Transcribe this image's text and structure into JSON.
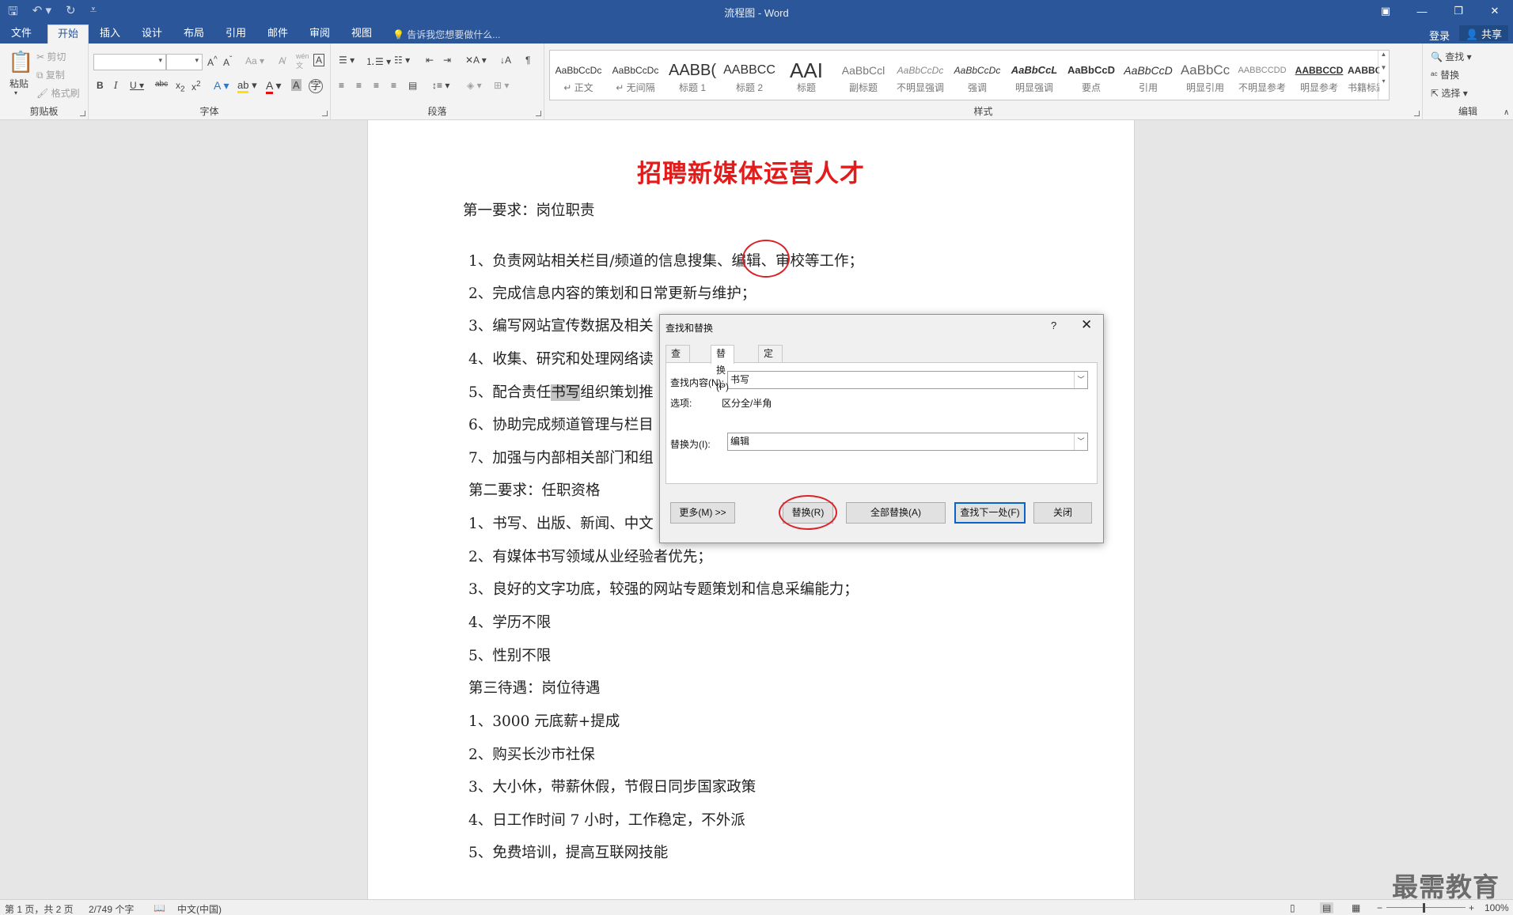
{
  "window": {
    "title": "流程图 - Word",
    "qat": [
      "save-icon",
      "undo-icon",
      "redo-icon",
      "customize-icon"
    ]
  },
  "tabs": [
    {
      "label": "文件"
    },
    {
      "label": "开始"
    },
    {
      "label": "插入"
    },
    {
      "label": "设计"
    },
    {
      "label": "布局"
    },
    {
      "label": "引用"
    },
    {
      "label": "邮件"
    },
    {
      "label": "审阅"
    },
    {
      "label": "视图"
    }
  ],
  "active_tab": "开始",
  "tell_me": "告诉我您想要做什么...",
  "account": {
    "login": "登录",
    "share": "共享"
  },
  "ribbon": {
    "clipboard": {
      "label": "剪贴板",
      "paste": "粘贴",
      "cut": "剪切",
      "copy": "复制",
      "format_painter": "格式刷"
    },
    "font": {
      "label": "字体",
      "font_name": "",
      "font_size": "",
      "aa_label": "Aa"
    },
    "paragraph": {
      "label": "段落"
    },
    "styles": {
      "label": "样式",
      "items": [
        {
          "preview": "AaBbCcDc",
          "name": "↵ 正文"
        },
        {
          "preview": "AaBbCcDc",
          "name": "↵ 无间隔"
        },
        {
          "preview": "AABB(",
          "name": "标题 1"
        },
        {
          "preview": "AABBCC",
          "name": "标题 2"
        },
        {
          "preview": "AAI",
          "name": "标题"
        },
        {
          "preview": "AaBbCcl",
          "name": "副标题"
        },
        {
          "preview": "AaBbCcDc",
          "name": "不明显强调"
        },
        {
          "preview": "AaBbCcDc",
          "name": "强调"
        },
        {
          "preview": "AaBbCcL",
          "name": "明显强调"
        },
        {
          "preview": "AaBbCcD",
          "name": "要点"
        },
        {
          "preview": "AaBbCcD",
          "name": "引用"
        },
        {
          "preview": "AaBbCc",
          "name": "明显引用"
        },
        {
          "preview": "AABBCCDD",
          "name": "不明显参考"
        },
        {
          "preview": "AABBCCD",
          "name": "明显参考"
        },
        {
          "preview": "AABBCCD",
          "name": "书籍标题"
        }
      ]
    },
    "editing": {
      "label": "编辑",
      "find": "查找",
      "replace": "替换",
      "select": "选择"
    }
  },
  "document": {
    "title": "招聘新媒体运营人才",
    "lines": [
      "第一要求：岗位职责",
      "1、负责网站相关栏目/频道的信息搜集、编辑、审校等工作；",
      "2、完成信息内容的策划和日常更新与维护；",
      "3、编写网站宣传数据及相关",
      "4、收集、研究和处理网络读",
      "5、配合责任书写组织策划推",
      "6、协助完成频道管理与栏目",
      "7、加强与内部相关部门和组",
      "第二要求：任职资格",
      "1、书写、出版、新闻、中文",
      "2、有媒体书写领域从业经验者优先；",
      "3、良好的文字功底，较强的网站专题策划和信息采编能力；",
      "4、学历不限",
      "5、性别不限",
      "第三待遇：岗位待遇",
      "1、3000 元底薪+提成",
      "2、购买长沙市社保",
      "3、大小休，带薪休假，节假日同步国家政策",
      "4、日工作时间 7 小时，工作稳定，不外派",
      "5、免费培训，提高互联网技能"
    ],
    "line1_parts": {
      "before": "1、负责网站相关栏目/频道的信息搜集、",
      "circled": "编辑",
      "after": "、审校等工作；"
    },
    "line5_parts": {
      "before": "5、配合责任",
      "highlight": "书写",
      "after": "组织策划推"
    }
  },
  "dialog": {
    "title": "查找和替换",
    "help": "?",
    "close": "✕",
    "tabs": [
      "查找(D)",
      "替换(P)",
      "定位(G)"
    ],
    "active_tab": "替换(P)",
    "find_label": "查找内容(N):",
    "find_value": "书写",
    "options_label": "选项:",
    "options_value": "区分全/半角",
    "replace_label": "替换为(I):",
    "replace_value": "编辑",
    "buttons": {
      "more": "更多(M) >>",
      "replace": "替换(R)",
      "replace_all": "全部替换(A)",
      "find_next": "查找下一处(F)",
      "close": "关闭"
    }
  },
  "status": {
    "page": "第 1 页，共 2 页",
    "words": "2/749 个字",
    "language": "中文(中国)",
    "zoom": "100%"
  },
  "watermark": "最需教育",
  "colors": {
    "accent": "#2b579a",
    "title_red": "#e21b1b",
    "annotation_red": "#d9232a"
  }
}
